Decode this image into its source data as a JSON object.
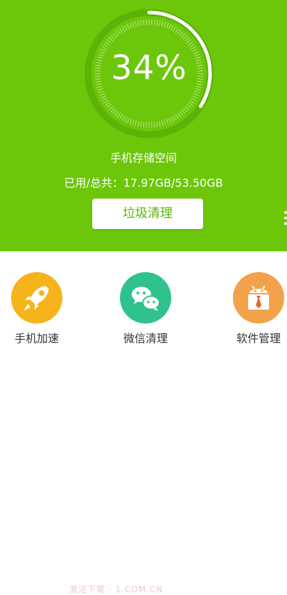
{
  "storage": {
    "percent_text": "34%",
    "percent_value": 0.34,
    "title": "手机存储空间",
    "usage_label": "已用/总共：17.97GB/53.50GB"
  },
  "actions": {
    "clean_label": "垃圾清理"
  },
  "tools": [
    {
      "label": "手机加速",
      "icon": "rocket-icon",
      "color": "#f6b41b"
    },
    {
      "label": "微信清理",
      "icon": "wechat-icon",
      "color": "#2fc28c"
    },
    {
      "label": "软件管理",
      "icon": "android-box-icon",
      "color": "#f2a24a"
    }
  ],
  "colors": {
    "primary": "#6cc70a",
    "button_text": "#5bb30a"
  },
  "watermark": "激活下载 · 1.COM.CN"
}
